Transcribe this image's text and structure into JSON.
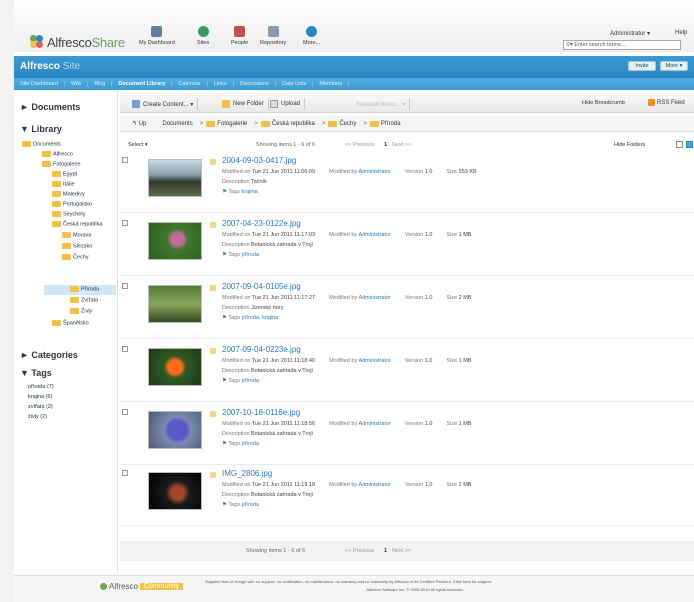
{
  "header": {
    "logo_prefix": "Alfresco",
    "logo_suffix": "Share",
    "nav": [
      "My Dashboard",
      "Sites",
      "People",
      "Repository",
      "More..."
    ],
    "user": "Administrator ▾",
    "help": "Help",
    "search_placeholder": "Enter search terms..."
  },
  "site": {
    "title": "Alfresco",
    "title_suffix": "Site",
    "invite": "Invite",
    "more": "More ▾",
    "tabs": [
      "Site Dashboard",
      "Wiki",
      "Blog",
      "Document Library",
      "Calendar",
      "Links",
      "Discussions",
      "Data Lists",
      "Members"
    ],
    "active_tab": "Document Library"
  },
  "left": {
    "documents": "► Documents",
    "library": "▼ Library",
    "tree": {
      "root": "Documents",
      "items": [
        "Alfresco",
        "Fotogalerie"
      ],
      "fotogalerie_children": [
        "Egypt",
        "Itálie",
        "Maledivy",
        "Portugalsko",
        "Seychely",
        "Česká republika"
      ],
      "cr_children": [
        "Morava",
        "Slezsko",
        "Čechy"
      ],
      "cechy_children": [
        "Příroda",
        "Zvířata",
        "Živly"
      ],
      "spanelsko": "Španělsko"
    },
    "categories": "► Categories",
    "tags_header": "▼ Tags",
    "tags": [
      "příroda (7)",
      "krajina (6)",
      "zvířata (2)",
      "živly (2)"
    ]
  },
  "toolbar": {
    "create": "Create Content... ▾",
    "new_folder": "New Folder",
    "upload": "Upload",
    "selected": "Selected Items... ▾",
    "hide_breadcrumb": "Hide Breadcrumb",
    "rss": "RSS Feed"
  },
  "breadcrumb": {
    "up": "Up",
    "parts": [
      "Documents",
      "Fotogalerie",
      "Česká republika",
      "Čechy",
      "Příroda"
    ]
  },
  "list": {
    "select": "Select ▾",
    "showing": "Showing items 1 - 6 of 6",
    "prev": "<< Previous",
    "page": "1",
    "next": "Next >>",
    "hide_folders": "Hide Folders",
    "labels": {
      "modified_on": "Modified on",
      "modified_by": "Modified by",
      "version": "Version",
      "size": "Size",
      "description": "Description",
      "tags": "Tags"
    },
    "items": [
      {
        "name": "2004-09-03-0417.jpg",
        "date": "Tue 21 Jun 2011 11:06:09",
        "by": "Administrator",
        "version": "1.0",
        "size": "553 KB",
        "desc": "Tačník",
        "tag": "krajina"
      },
      {
        "name": "2007-04-23-0122e.jpg",
        "date": "Tue 21 Jun 2011 11:17:03",
        "by": "Administrator",
        "version": "1.0",
        "size": "1 MB",
        "desc": "Botanická zahrada v Troji",
        "tag": "příroda"
      },
      {
        "name": "2007-09-04-0105e.jpg",
        "date": "Tue 21 Jun 2011 11:17:27",
        "by": "Administrator",
        "version": "1.0",
        "size": "2 MB",
        "desc": "Jizerské hory",
        "tag": "příroda, krajina"
      },
      {
        "name": "2007-09-04-0223e.jpg",
        "date": "Tue 21 Jun 2011 11:18:40",
        "by": "Administrator",
        "version": "1.0",
        "size": "1 MB",
        "desc": "Botanická zahrada v Troji",
        "tag": "příroda"
      },
      {
        "name": "2007-10-18-0116e.jpg",
        "date": "Tue 21 Jun 2011 11:18:56",
        "by": "Administrator",
        "version": "1.0",
        "size": "1 MB",
        "desc": "Botanická zahrada v Troji",
        "tag": "příroda"
      },
      {
        "name": "IMG_2806.jpg",
        "date": "Tue 21 Jun 2011 11:19:18",
        "by": "Administrator",
        "version": "1.0",
        "size": "2 MB",
        "desc": "Botanická zahrada v Troji",
        "tag": "příroda"
      }
    ]
  },
  "footer": {
    "logo": "Alfresco",
    "badge": "Community",
    "line1": "Supplied free of charge with no support, no certification, no maintenance, no warranty and no indemnity by Alfresco or its Certified Partners. Click here for support.",
    "line2": "Alfresco Software Inc. © 2005-2010 All rights reserved."
  },
  "colors": {
    "accent": "#2a86c3",
    "link": "#2a7bc0",
    "folder": "#f0c04a"
  }
}
